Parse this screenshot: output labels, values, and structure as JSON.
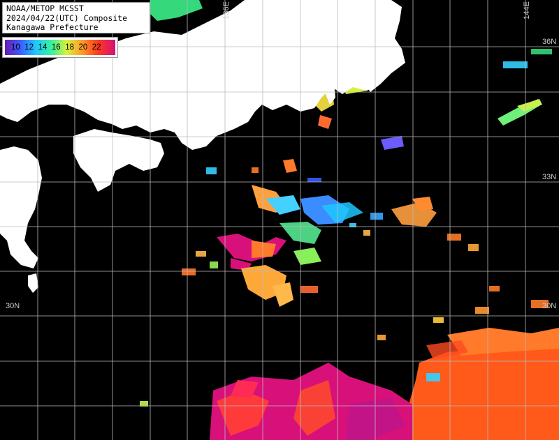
{
  "title": {
    "line1": "NOAA/METOP MCSST",
    "line2": "2024/04/22(UTC) Composite",
    "line3": "Kanagawa Prefecture"
  },
  "scale": {
    "ticks": [
      "10",
      "12",
      "14",
      "16",
      "18",
      "20",
      "22"
    ],
    "colors": [
      "#6a1bb0",
      "#3a5cff",
      "#1fc8ff",
      "#35f2a0",
      "#d8f23a",
      "#ff9a2a",
      "#ff3a1a",
      "#d4107a"
    ]
  },
  "grid_labels": {
    "lon_136": "136E",
    "lon_144": "144E",
    "lat_36": "36N",
    "lat_33": "33N",
    "lat_30_left": "30N",
    "lat_30_right": "30N"
  },
  "colors": {
    "land": "#ffffff",
    "ocean_nodata": "#000000",
    "grid": "#bbbbbb"
  }
}
